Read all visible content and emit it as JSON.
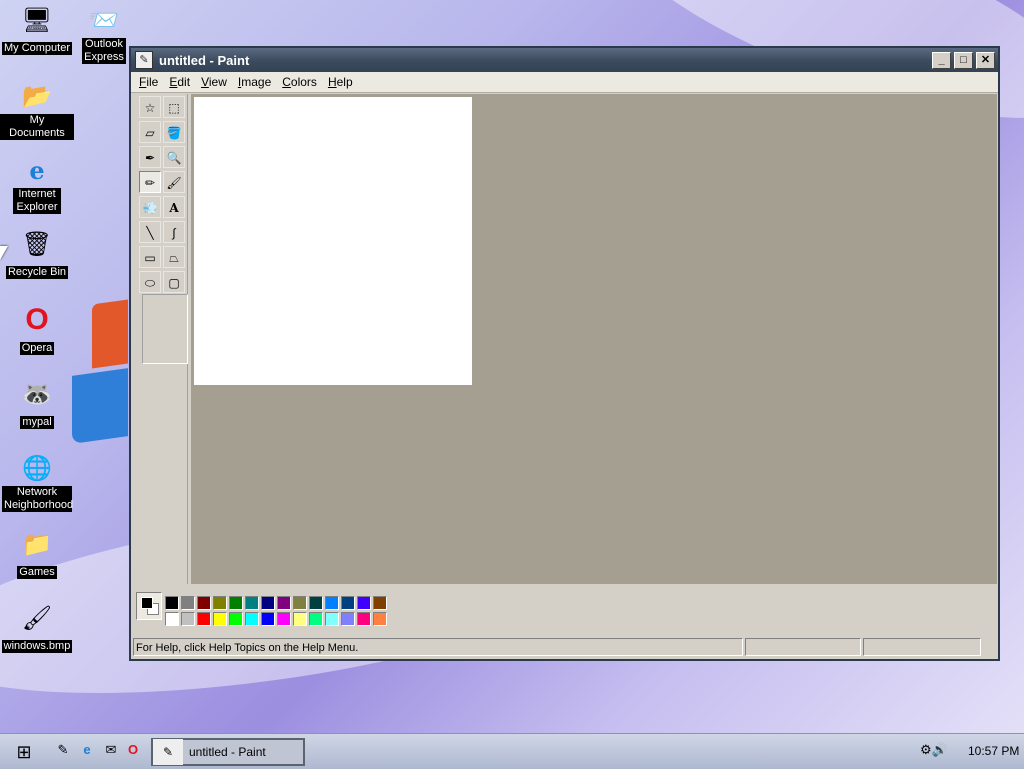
{
  "desktop": {
    "icons": [
      {
        "label": "My Computer",
        "glyph": "🖥"
      },
      {
        "label": "Outlook Express",
        "glyph": "📨"
      },
      {
        "label": "My Documents",
        "glyph": "📂"
      },
      {
        "label": "Internet Explorer",
        "glyph": "e"
      },
      {
        "label": "Recycle Bin",
        "glyph": "🗑"
      },
      {
        "label": "Opera",
        "glyph": "O"
      },
      {
        "label": "mypal",
        "glyph": "🦝"
      },
      {
        "label": "Network Neighborhood",
        "glyph": "🌐"
      },
      {
        "label": "Games",
        "glyph": "📁"
      },
      {
        "label": "windows.bmp",
        "glyph": "🖌"
      }
    ]
  },
  "window": {
    "title": "untitled - Paint",
    "buttons": {
      "minimize": "_",
      "maximize": "□",
      "close": "✕"
    },
    "menu": [
      "File",
      "Edit",
      "View",
      "Image",
      "Colors",
      "Help"
    ],
    "tools": [
      {
        "name": "free-form-select",
        "glyph": "☆"
      },
      {
        "name": "select",
        "glyph": "⬚"
      },
      {
        "name": "eraser",
        "glyph": "▱"
      },
      {
        "name": "fill",
        "glyph": "🪣"
      },
      {
        "name": "pick-color",
        "glyph": "✒"
      },
      {
        "name": "magnifier",
        "glyph": "🔍"
      },
      {
        "name": "pencil",
        "glyph": "✏"
      },
      {
        "name": "brush",
        "glyph": "🖌"
      },
      {
        "name": "airbrush",
        "glyph": "💨"
      },
      {
        "name": "text",
        "glyph": "A"
      },
      {
        "name": "line",
        "glyph": "╲"
      },
      {
        "name": "curve",
        "glyph": "∫"
      },
      {
        "name": "rectangle",
        "glyph": "▭"
      },
      {
        "name": "polygon",
        "glyph": "⏢"
      },
      {
        "name": "ellipse",
        "glyph": "⬭"
      },
      {
        "name": "rounded-rectangle",
        "glyph": "▢"
      }
    ],
    "selected_tool": "pencil",
    "foreground_color": "#000000",
    "background_color": "#ffffff",
    "palette_top": [
      "#000000",
      "#808080",
      "#800000",
      "#808000",
      "#008000",
      "#008080",
      "#000080",
      "#800080",
      "#808040",
      "#004040",
      "#0080ff",
      "#004080",
      "#4000ff",
      "#804000"
    ],
    "palette_bottom": [
      "#ffffff",
      "#c0c0c0",
      "#ff0000",
      "#ffff00",
      "#00ff00",
      "#00ffff",
      "#0000ff",
      "#ff00ff",
      "#ffff80",
      "#00ff80",
      "#80ffff",
      "#8080ff",
      "#ff0080",
      "#ff8040"
    ],
    "status": "For Help, click Help Topics on the Help Menu."
  },
  "taskbar": {
    "task_label": "untitled - Paint",
    "clock": "10:57 PM"
  }
}
